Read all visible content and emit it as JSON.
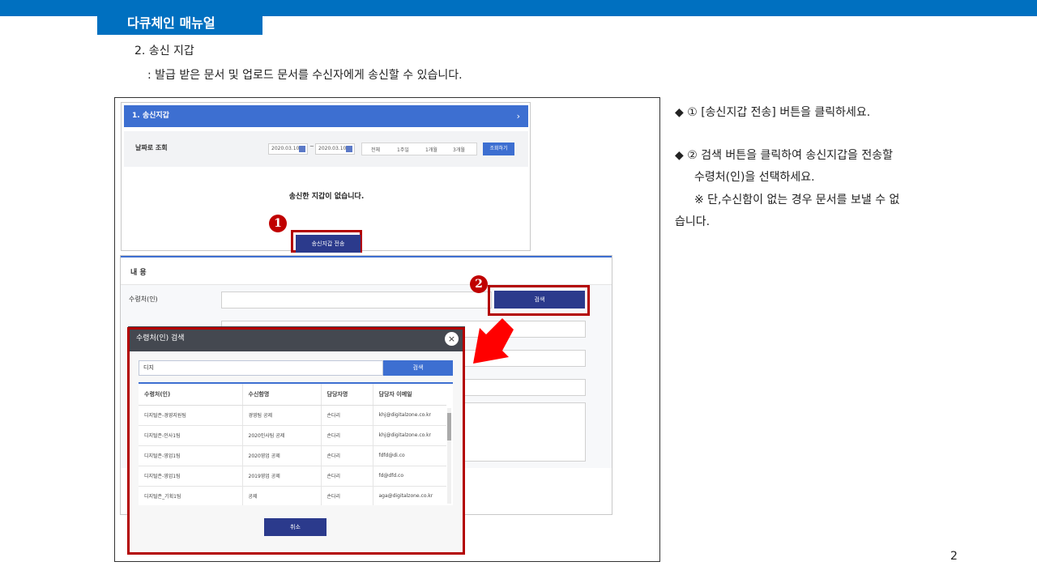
{
  "header": {
    "manual_title": "다큐체인 매뉴얼"
  },
  "section": {
    "heading": "2. 송신 지갑",
    "description": ": 발급 받은 문서 및 업로드 문서를 수신자에게 송신할 수 있습니다."
  },
  "panel1": {
    "title": "1. 송신지갑",
    "chevron": "›",
    "filter_label": "날짜로 조회",
    "date_from": "2020.03.10",
    "date_sep": "~",
    "date_to": "2020.03.10",
    "periods": [
      "전체",
      "1주일",
      "1개월",
      "3개월"
    ],
    "query_button": "조회하기",
    "empty_message": "송신한 지갑이 없습니다.",
    "send_button": "송신지갑 전송"
  },
  "badges": {
    "one": "1",
    "two": "2"
  },
  "panel2": {
    "title": "내 용",
    "recipient_label": "수령처(인)",
    "search_button": "검색"
  },
  "modal": {
    "title": "수령처(인) 검색",
    "close": "×",
    "search_value": "디지",
    "search_button": "검색",
    "columns": [
      "수령처(인)",
      "수신함명",
      "담당자명",
      "담당자 이메일"
    ],
    "rows": [
      [
        "디지털존-경영지원팀",
        "경영팀 공제",
        "손다리",
        "khj@digitalzone.co.kr"
      ],
      [
        "디지털존-인사1팀",
        "2020인사팀 공제",
        "손다리",
        "khj@digitalzone.co.kr"
      ],
      [
        "디지털존-영업1팀",
        "2020영업 공제",
        "손다리",
        "fdfd@di.co"
      ],
      [
        "디지털존-영업1팀",
        "2019영업 공제",
        "손다리",
        "fd@dfd.co"
      ],
      [
        "디지털존_기획1팀",
        "공제",
        "손다리",
        "aga@digitalzone.co.kr"
      ]
    ],
    "cancel_button": "취소"
  },
  "instructions": {
    "step1": "◆ ① [송신지갑 전송] 버튼을 클릭하세요.",
    "step2_line1": "◆ ② 검색 버튼을 클릭하여 송신지갑을 전송할",
    "step2_line2": "수령처(인)을 선택하세요.",
    "note_line1": "※  단,수신함이 없는 경우 문서를 보낼 수 없",
    "note_line2": "습니다."
  },
  "page_number": "2",
  "colors": {
    "brand_blue": "#0070c0",
    "panel_blue": "#3d6fd1",
    "button_navy": "#2b3a8c",
    "highlight_red": "#c00000",
    "arrow_red": "#ff0000"
  }
}
